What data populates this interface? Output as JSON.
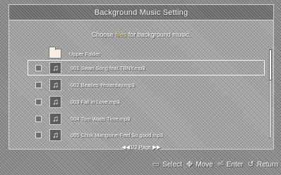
{
  "title": "Background Music Setting",
  "instruction": {
    "prefix": "Choose",
    "highlight": "files",
    "suffix": "for background music."
  },
  "upper_folder": "Upper Folder",
  "files": [
    {
      "name": "001 Swan Song feat.TBNY.mp3",
      "selected": true
    },
    {
      "name": "002 Beatles Yesterday.mp3",
      "selected": false
    },
    {
      "name": "003 Fall in Love.mp3",
      "selected": false
    },
    {
      "name": "004 Tom Waits Time.mp3",
      "selected": false
    },
    {
      "name": "005 Chuk Mangione-Feel So good.mp3",
      "selected": false
    }
  ],
  "pager": {
    "left_arrows": "◀◀",
    "text": "1/2 Page",
    "right_arrows": "▶▶"
  },
  "scroll_fraction": 0.35,
  "footer": {
    "select": {
      "icon": "enter-key-icon",
      "label": "Select"
    },
    "move": {
      "icon": "dpad-icon",
      "label": "Move"
    },
    "enter": {
      "icon": "enter-icon",
      "label": "Enter"
    },
    "return": {
      "icon": "return-icon",
      "label": "Return"
    }
  }
}
